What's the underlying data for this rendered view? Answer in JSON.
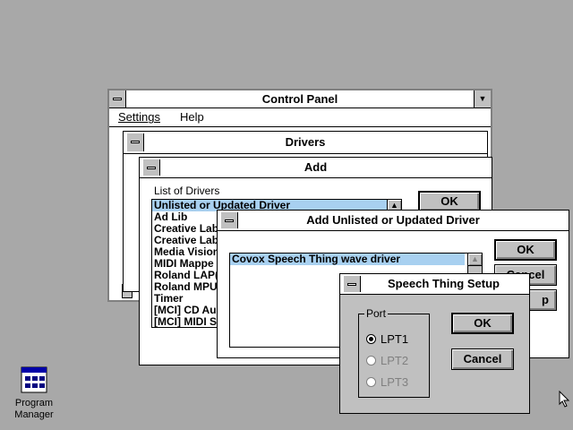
{
  "desktop": {
    "icon_program_manager": {
      "label_line1": "Program",
      "label_line2": "Manager"
    }
  },
  "control_panel": {
    "title": "Control Panel",
    "menu": {
      "settings": "Settings",
      "help": "Help"
    }
  },
  "drivers": {
    "title": "Drivers"
  },
  "add": {
    "title": "Add",
    "list_label": "List of Drivers",
    "ok": "OK",
    "items": [
      "Unlisted or Updated Driver",
      "Ad Lib",
      "Creative Lab",
      "Creative Lab",
      "Media Vision",
      "MIDI Mappe",
      "Roland LAP(",
      "Roland MPU",
      "Timer",
      "[MCI] CD Au",
      "[MCI] MIDI S"
    ]
  },
  "add_unlisted": {
    "title": "Add Unlisted or Updated Driver",
    "list_item": "Covox Speech Thing wave driver",
    "ok": "OK",
    "cancel_partial": "Cancel",
    "help_partial": "p"
  },
  "speech_setup": {
    "title": "Speech Thing Setup",
    "group_label": "Port",
    "options": [
      "LPT1",
      "LPT2",
      "LPT3"
    ],
    "ok": "OK",
    "cancel": "Cancel"
  }
}
